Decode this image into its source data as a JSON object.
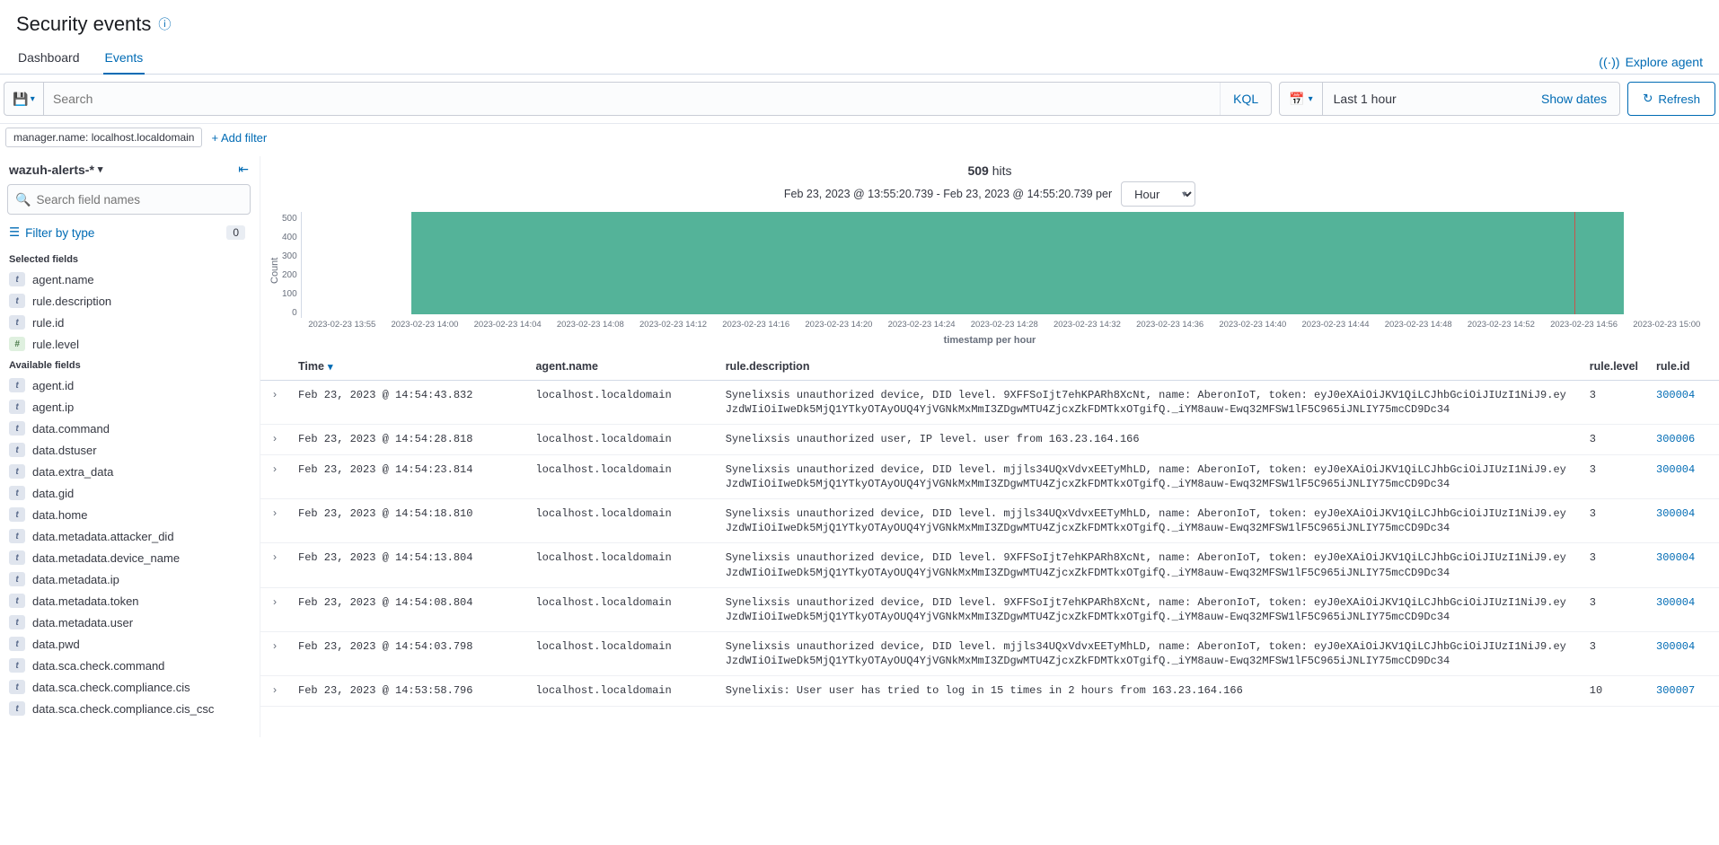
{
  "header": {
    "title": "Security events",
    "tabs": [
      "Dashboard",
      "Events"
    ],
    "active_tab": "Events",
    "explore_agent": "Explore agent"
  },
  "query_bar": {
    "search_placeholder": "Search",
    "kql_label": "KQL",
    "date_value": "Last 1 hour",
    "show_dates": "Show dates",
    "refresh": "Refresh"
  },
  "filters": {
    "pill": "manager.name: localhost.localdomain",
    "add": "+ Add filter"
  },
  "sidebar": {
    "index_pattern": "wazuh-alerts-*",
    "field_search_placeholder": "Search field names",
    "filter_by_type": "Filter by type",
    "filter_count": "0",
    "selected_label": "Selected fields",
    "selected_fields": [
      {
        "type": "t",
        "name": "agent.name"
      },
      {
        "type": "t",
        "name": "rule.description"
      },
      {
        "type": "t",
        "name": "rule.id"
      },
      {
        "type": "n",
        "name": "rule.level"
      }
    ],
    "available_label": "Available fields",
    "available_fields": [
      {
        "type": "t",
        "name": "agent.id"
      },
      {
        "type": "t",
        "name": "agent.ip"
      },
      {
        "type": "t",
        "name": "data.command"
      },
      {
        "type": "t",
        "name": "data.dstuser"
      },
      {
        "type": "t",
        "name": "data.extra_data"
      },
      {
        "type": "t",
        "name": "data.gid"
      },
      {
        "type": "t",
        "name": "data.home"
      },
      {
        "type": "t",
        "name": "data.metadata.attacker_did"
      },
      {
        "type": "t",
        "name": "data.metadata.device_name"
      },
      {
        "type": "t",
        "name": "data.metadata.ip"
      },
      {
        "type": "t",
        "name": "data.metadata.token"
      },
      {
        "type": "t",
        "name": "data.metadata.user"
      },
      {
        "type": "t",
        "name": "data.pwd"
      },
      {
        "type": "t",
        "name": "data.sca.check.command"
      },
      {
        "type": "t",
        "name": "data.sca.check.compliance.cis"
      },
      {
        "type": "t",
        "name": "data.sca.check.compliance.cis_csc"
      }
    ]
  },
  "content": {
    "hits": "509",
    "hits_suffix": " hits",
    "range": "Feb 23, 2023 @ 13:55:20.739 - Feb 23, 2023 @ 14:55:20.739 per",
    "per_value": "Hour"
  },
  "chart_data": {
    "type": "bar",
    "ylabel": "Count",
    "xlabel": "timestamp per hour",
    "y_ticks": [
      "500",
      "400",
      "300",
      "200",
      "100",
      "0"
    ],
    "x_ticks": [
      "2023-02-23 13:55",
      "2023-02-23 14:00",
      "2023-02-23 14:04",
      "2023-02-23 14:08",
      "2023-02-23 14:12",
      "2023-02-23 14:16",
      "2023-02-23 14:20",
      "2023-02-23 14:24",
      "2023-02-23 14:28",
      "2023-02-23 14:32",
      "2023-02-23 14:36",
      "2023-02-23 14:40",
      "2023-02-23 14:44",
      "2023-02-23 14:48",
      "2023-02-23 14:52",
      "2023-02-23 14:56",
      "2023-02-23 15:00"
    ],
    "categories": [
      "2023-02-23 14:00"
    ],
    "values": [
      509
    ],
    "ylim": [
      0,
      550
    ],
    "bar_start_frac": 0.078,
    "bar_end_frac": 0.94,
    "marker_frac": 0.905
  },
  "table": {
    "columns": [
      "Time",
      "agent.name",
      "rule.description",
      "rule.level",
      "rule.id"
    ],
    "rows": [
      {
        "time": "Feb 23, 2023 @ 14:54:43.832",
        "agent": "localhost.localdomain",
        "desc": "Synelixsis unauthorized device, DID level. 9XFFSoIjt7ehKPARh8XcNt, name: AberonIoT, token: eyJ0eXAiOiJKV1QiLCJhbGciOiJIUzI1NiJ9.eyJzdWIiOiIweDk5MjQ1YTkyOTAyOUQ4YjVGNkMxMmI3ZDgwMTU4ZjcxZkFDMTkxOTgifQ._iYM8auw-Ewq32MFSW1lF5C965iJNLIY75mcCD9Dc34",
        "level": "3",
        "rule": "300004"
      },
      {
        "time": "Feb 23, 2023 @ 14:54:28.818",
        "agent": "localhost.localdomain",
        "desc": "Synelixsis unauthorized user, IP level. user from 163.23.164.166",
        "level": "3",
        "rule": "300006"
      },
      {
        "time": "Feb 23, 2023 @ 14:54:23.814",
        "agent": "localhost.localdomain",
        "desc": "Synelixsis unauthorized device, DID level. mjjls34UQxVdvxEETyMhLD, name: AberonIoT, token: eyJ0eXAiOiJKV1QiLCJhbGciOiJIUzI1NiJ9.eyJzdWIiOiIweDk5MjQ1YTkyOTAyOUQ4YjVGNkMxMmI3ZDgwMTU4ZjcxZkFDMTkxOTgifQ._iYM8auw-Ewq32MFSW1lF5C965iJNLIY75mcCD9Dc34",
        "level": "3",
        "rule": "300004"
      },
      {
        "time": "Feb 23, 2023 @ 14:54:18.810",
        "agent": "localhost.localdomain",
        "desc": "Synelixsis unauthorized device, DID level. mjjls34UQxVdvxEETyMhLD, name: AberonIoT, token: eyJ0eXAiOiJKV1QiLCJhbGciOiJIUzI1NiJ9.eyJzdWIiOiIweDk5MjQ1YTkyOTAyOUQ4YjVGNkMxMmI3ZDgwMTU4ZjcxZkFDMTkxOTgifQ._iYM8auw-Ewq32MFSW1lF5C965iJNLIY75mcCD9Dc34",
        "level": "3",
        "rule": "300004"
      },
      {
        "time": "Feb 23, 2023 @ 14:54:13.804",
        "agent": "localhost.localdomain",
        "desc": "Synelixsis unauthorized device, DID level. 9XFFSoIjt7ehKPARh8XcNt, name: AberonIoT, token: eyJ0eXAiOiJKV1QiLCJhbGciOiJIUzI1NiJ9.eyJzdWIiOiIweDk5MjQ1YTkyOTAyOUQ4YjVGNkMxMmI3ZDgwMTU4ZjcxZkFDMTkxOTgifQ._iYM8auw-Ewq32MFSW1lF5C965iJNLIY75mcCD9Dc34",
        "level": "3",
        "rule": "300004"
      },
      {
        "time": "Feb 23, 2023 @ 14:54:08.804",
        "agent": "localhost.localdomain",
        "desc": "Synelixsis unauthorized device, DID level. 9XFFSoIjt7ehKPARh8XcNt, name: AberonIoT, token: eyJ0eXAiOiJKV1QiLCJhbGciOiJIUzI1NiJ9.eyJzdWIiOiIweDk5MjQ1YTkyOTAyOUQ4YjVGNkMxMmI3ZDgwMTU4ZjcxZkFDMTkxOTgifQ._iYM8auw-Ewq32MFSW1lF5C965iJNLIY75mcCD9Dc34",
        "level": "3",
        "rule": "300004"
      },
      {
        "time": "Feb 23, 2023 @ 14:54:03.798",
        "agent": "localhost.localdomain",
        "desc": "Synelixsis unauthorized device, DID level. mjjls34UQxVdvxEETyMhLD, name: AberonIoT, token: eyJ0eXAiOiJKV1QiLCJhbGciOiJIUzI1NiJ9.eyJzdWIiOiIweDk5MjQ1YTkyOTAyOUQ4YjVGNkMxMmI3ZDgwMTU4ZjcxZkFDMTkxOTgifQ._iYM8auw-Ewq32MFSW1lF5C965iJNLIY75mcCD9Dc34",
        "level": "3",
        "rule": "300004"
      },
      {
        "time": "Feb 23, 2023 @ 14:53:58.796",
        "agent": "localhost.localdomain",
        "desc": "Synelixis: User user has tried to log in 15 times in 2 hours from 163.23.164.166",
        "level": "10",
        "rule": "300007"
      }
    ]
  }
}
